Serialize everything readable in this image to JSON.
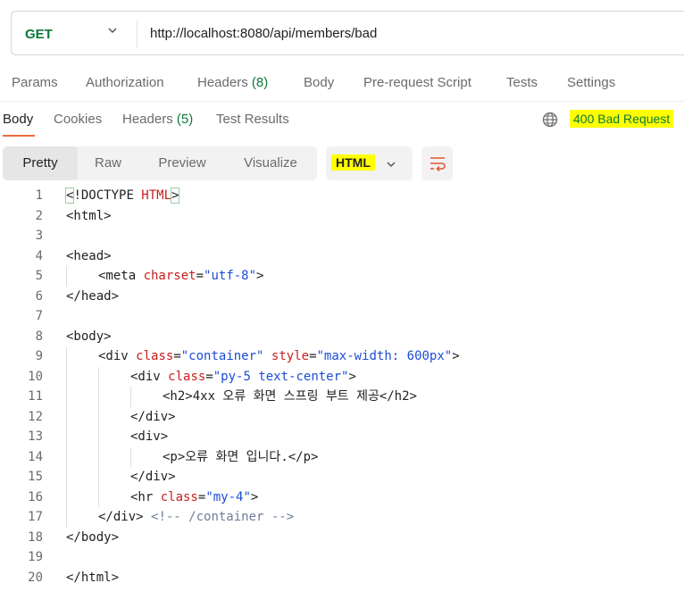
{
  "request": {
    "method": "GET",
    "url": "http://localhost:8080/api/members/bad"
  },
  "request_tabs": [
    {
      "label": "Params",
      "count": ""
    },
    {
      "label": "Authorization",
      "count": ""
    },
    {
      "label": "Headers",
      "count": "(8)"
    },
    {
      "label": "Body",
      "count": ""
    },
    {
      "label": "Pre-request Script",
      "count": ""
    },
    {
      "label": "Tests",
      "count": ""
    },
    {
      "label": "Settings",
      "count": ""
    }
  ],
  "response_tabs": [
    {
      "label": "Body",
      "count": ""
    },
    {
      "label": "Cookies",
      "count": ""
    },
    {
      "label": "Headers",
      "count": "(5)"
    },
    {
      "label": "Test Results",
      "count": ""
    }
  ],
  "response_status": "400 Bad Request",
  "view_modes": [
    "Pretty",
    "Raw",
    "Preview",
    "Visualize"
  ],
  "language": "HTML",
  "icons": {
    "method_dropdown": "chevron-down-icon",
    "globe": "globe-icon",
    "language_dropdown": "chevron-down-icon",
    "wrap": "wrap-lines-icon"
  },
  "colors": {
    "method": "#0b7a3a",
    "status": "#0b7a3a",
    "highlight": "#ffff00",
    "active_tab_underline": "#f26b3a",
    "attribute": "#c8201f",
    "attribute_value": "#1b4dd6",
    "comment": "#6e7c99"
  },
  "code_lines": [
    {
      "n": "1",
      "indent": 0,
      "t": [
        [
          "tg",
          "<"
        ],
        [
          "tn",
          "!DOCTYPE "
        ],
        [
          "at",
          "HTML"
        ],
        [
          "tg",
          ">"
        ]
      ]
    },
    {
      "n": "2",
      "indent": 0,
      "t": [
        [
          "tg",
          "<html>"
        ]
      ]
    },
    {
      "n": "3",
      "indent": 0,
      "t": []
    },
    {
      "n": "4",
      "indent": 0,
      "t": [
        [
          "tg",
          "<head>"
        ]
      ]
    },
    {
      "n": "5",
      "indent": 1,
      "t": [
        [
          "tg",
          "<meta "
        ],
        [
          "at",
          "charset"
        ],
        [
          "tg",
          "="
        ],
        [
          "av",
          "\"utf-8\""
        ],
        [
          "tg",
          ">"
        ]
      ]
    },
    {
      "n": "6",
      "indent": 0,
      "t": [
        [
          "tg",
          "</head>"
        ]
      ]
    },
    {
      "n": "7",
      "indent": 0,
      "t": []
    },
    {
      "n": "8",
      "indent": 0,
      "t": [
        [
          "tg",
          "<body>"
        ]
      ]
    },
    {
      "n": "9",
      "indent": 1,
      "t": [
        [
          "tg",
          "<div "
        ],
        [
          "at",
          "class"
        ],
        [
          "tg",
          "="
        ],
        [
          "av",
          "\"container\""
        ],
        [
          "tg",
          " "
        ],
        [
          "at",
          "style"
        ],
        [
          "tg",
          "="
        ],
        [
          "av",
          "\"max-width: 600px\""
        ],
        [
          "tg",
          ">"
        ]
      ]
    },
    {
      "n": "10",
      "indent": 2,
      "t": [
        [
          "tg",
          "<div "
        ],
        [
          "at",
          "class"
        ],
        [
          "tg",
          "="
        ],
        [
          "av",
          "\"py-5 text-center\""
        ],
        [
          "tg",
          ">"
        ]
      ]
    },
    {
      "n": "11",
      "indent": 3,
      "t": [
        [
          "tg",
          "<h2>"
        ],
        [
          "tx",
          "4xx 오류 화면 스프링 부트 제공"
        ],
        [
          "tg",
          "</h2>"
        ]
      ]
    },
    {
      "n": "12",
      "indent": 2,
      "t": [
        [
          "tg",
          "</div>"
        ]
      ]
    },
    {
      "n": "13",
      "indent": 2,
      "t": [
        [
          "tg",
          "<div>"
        ]
      ]
    },
    {
      "n": "14",
      "indent": 3,
      "t": [
        [
          "tg",
          "<p>"
        ],
        [
          "tx",
          "오류 화면 입니다."
        ],
        [
          "tg",
          "</p>"
        ]
      ]
    },
    {
      "n": "15",
      "indent": 2,
      "t": [
        [
          "tg",
          "</div>"
        ]
      ]
    },
    {
      "n": "16",
      "indent": 2,
      "t": [
        [
          "tg",
          "<hr "
        ],
        [
          "at",
          "class"
        ],
        [
          "tg",
          "="
        ],
        [
          "av",
          "\"my-4\""
        ],
        [
          "tg",
          ">"
        ]
      ]
    },
    {
      "n": "17",
      "indent": 1,
      "t": [
        [
          "tg",
          "</div> "
        ],
        [
          "cm",
          "<!-- /container -->"
        ]
      ]
    },
    {
      "n": "18",
      "indent": 0,
      "t": [
        [
          "tg",
          "</body>"
        ]
      ]
    },
    {
      "n": "19",
      "indent": 0,
      "t": []
    },
    {
      "n": "20",
      "indent": 0,
      "t": [
        [
          "tg",
          "</html>"
        ]
      ]
    }
  ]
}
